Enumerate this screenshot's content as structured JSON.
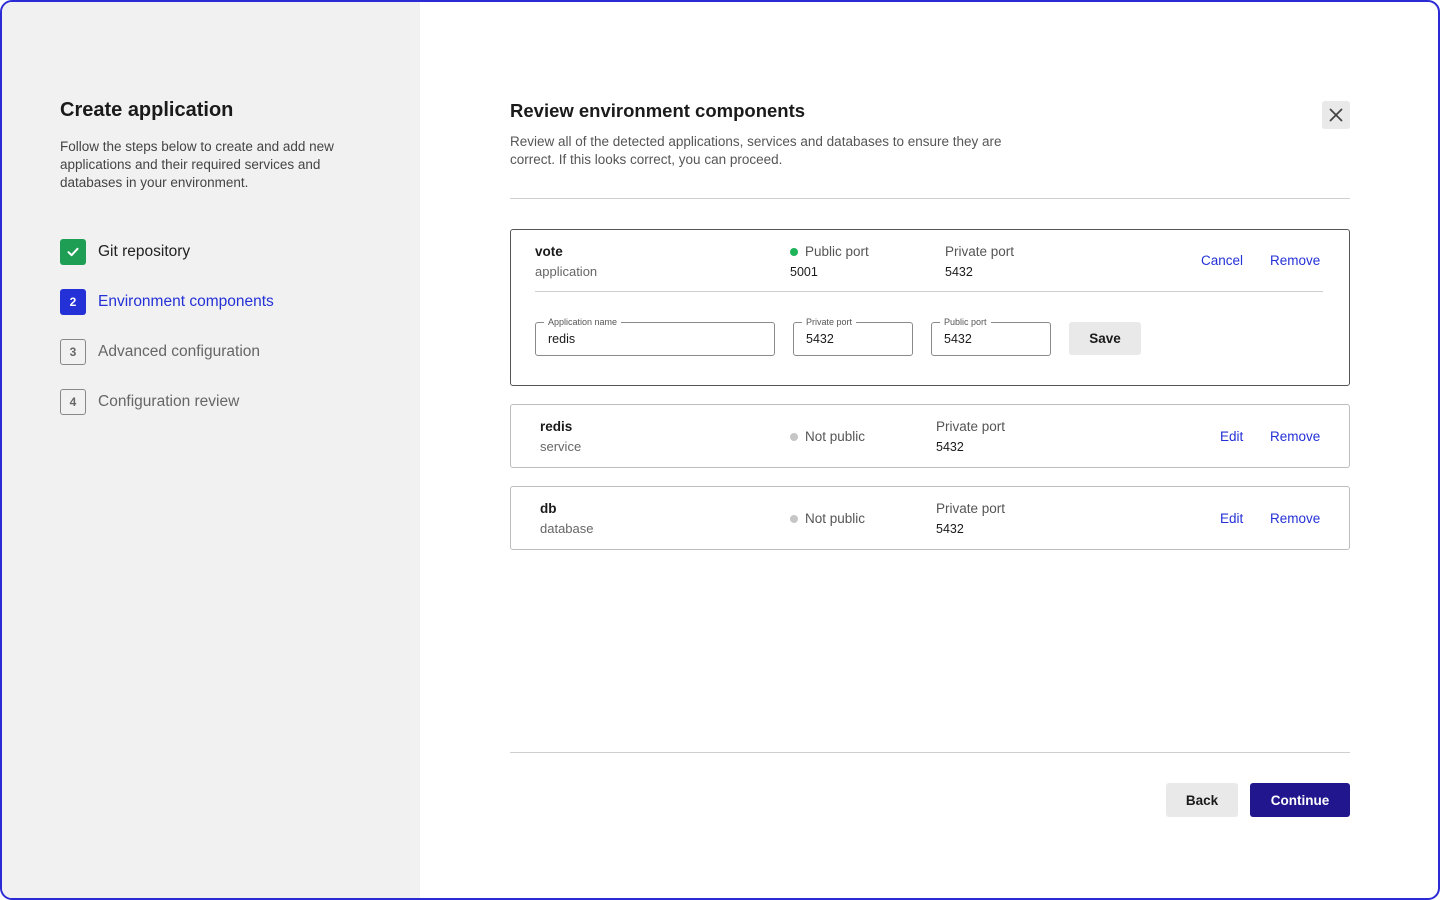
{
  "sidebar": {
    "title": "Create application",
    "description": "Follow the steps below to create and add new applications and their required services and databases in your environment.",
    "steps": [
      {
        "number": "",
        "label": "Git repository",
        "state": "done"
      },
      {
        "number": "2",
        "label": "Environment components",
        "state": "active"
      },
      {
        "number": "3",
        "label": "Advanced configuration",
        "state": "todo"
      },
      {
        "number": "4",
        "label": "Configuration review",
        "state": "todo"
      }
    ]
  },
  "main": {
    "title": "Review environment components",
    "description": "Review all of the detected applications, services and databases to ensure they are correct. If this looks correct, you can proceed.",
    "components": [
      {
        "name": "vote",
        "type": "application",
        "status_label": "Public port",
        "status_value": "5001",
        "status_color": "#1fb35a",
        "private_label": "Private port",
        "private_value": "5432",
        "action_label": "Cancel",
        "remove_label": "Remove",
        "edit_form": {
          "app_name_label": "Application name",
          "app_name_value": "redis",
          "private_port_label": "Private port",
          "private_port_value": "5432",
          "public_port_label": "Public port",
          "public_port_value": "5432",
          "save_label": "Save"
        }
      },
      {
        "name": "redis",
        "type": "service",
        "status_label": "Not public",
        "status_color": "#c6c6c6",
        "private_label": "Private port",
        "private_value": "5432",
        "action_label": "Edit",
        "remove_label": "Remove"
      },
      {
        "name": "db",
        "type": "database",
        "status_label": "Not public",
        "status_color": "#c6c6c6",
        "private_label": "Private port",
        "private_value": "5432",
        "action_label": "Edit",
        "remove_label": "Remove"
      }
    ]
  },
  "footer": {
    "back_label": "Back",
    "continue_label": "Continue"
  },
  "icons": {
    "close": "close-icon",
    "check": "check-icon"
  },
  "colors": {
    "accent": "#2431d6",
    "success": "#1fb35a",
    "primary_button": "#22168f",
    "sidebar_bg": "#f1f1f1"
  }
}
